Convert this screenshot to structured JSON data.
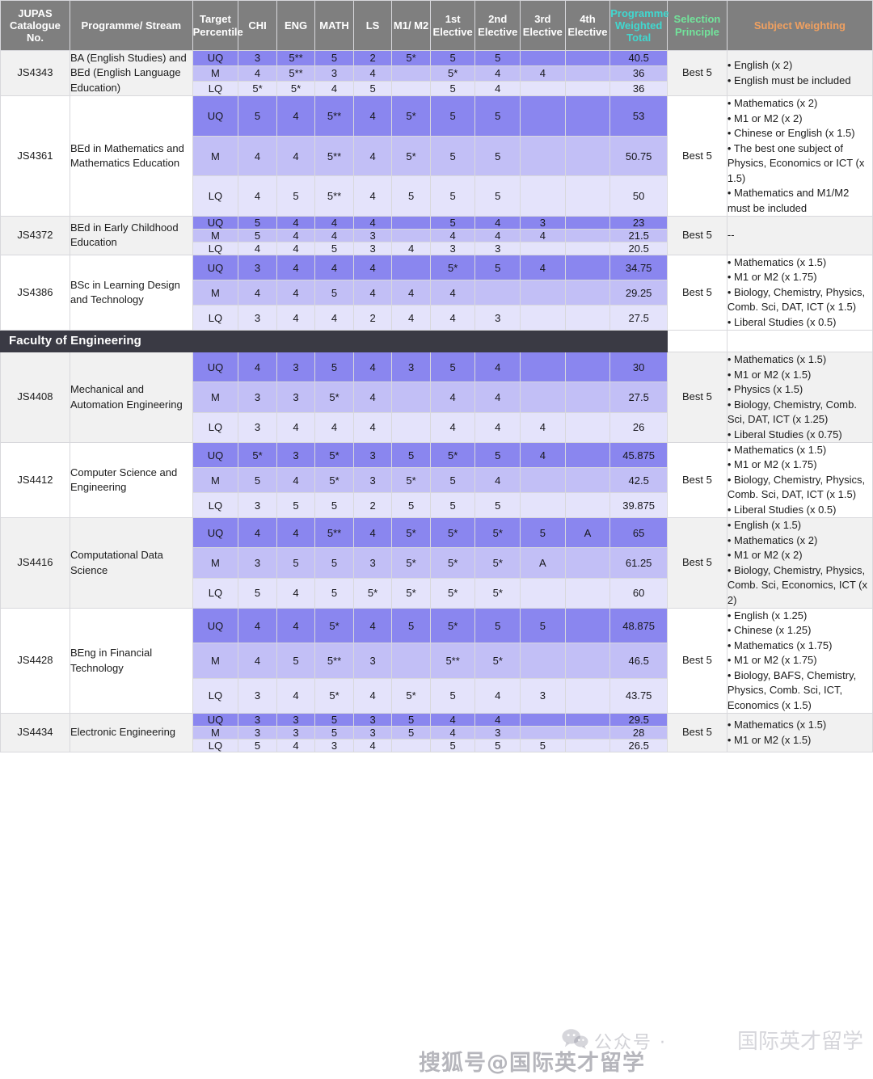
{
  "table": {
    "headers": [
      {
        "key": "jupas",
        "label": "JUPAS Catalogue No."
      },
      {
        "key": "programme",
        "label": "Programme/ Stream"
      },
      {
        "key": "target",
        "label": "Target Percentile"
      },
      {
        "key": "chi",
        "label": "CHI"
      },
      {
        "key": "eng",
        "label": "ENG"
      },
      {
        "key": "math",
        "label": "MATH"
      },
      {
        "key": "ls",
        "label": "LS"
      },
      {
        "key": "m1m2",
        "label": "M1/ M2"
      },
      {
        "key": "e1",
        "label": "1st Elective"
      },
      {
        "key": "e2",
        "label": "2nd Elective"
      },
      {
        "key": "e3",
        "label": "3rd Elective"
      },
      {
        "key": "e4",
        "label": "4th Elective"
      },
      {
        "key": "total",
        "label": "Programme Weighted Total"
      },
      {
        "key": "selection",
        "label": "Selection Principle"
      },
      {
        "key": "weighting",
        "label": "Subject Weighting"
      }
    ],
    "header_colors": {
      "background": "#7f7f7f",
      "default_text": "#ffffff",
      "programme_weighted_total": "#40d8d0",
      "selection_principle": "#72e39b",
      "subject_weighting": "#f0a060"
    },
    "quartile_colors": {
      "UQ": "#8a86ef",
      "M": "#c2bff6",
      "LQ": "#e4e3fb"
    },
    "faculty_band_color": "#3a3a44"
  },
  "sections": [
    {
      "faculty": null,
      "programmes": [
        {
          "id": "JS4343",
          "name": "BA (English Studies) and BEd (English Language Education)",
          "selection": "Best 5",
          "weighting": [
            "• English (x 2)",
            "• English must be included"
          ],
          "rows": [
            {
              "q": "UQ",
              "chi": "3",
              "eng": "5**",
              "math": "5",
              "ls": "2",
              "m1m2": "5*",
              "e1": "5",
              "e2": "5",
              "e3": "",
              "e4": "",
              "total": "40.5"
            },
            {
              "q": "M",
              "chi": "4",
              "eng": "5**",
              "math": "3",
              "ls": "4",
              "m1m2": "",
              "e1": "5*",
              "e2": "4",
              "e3": "4",
              "e4": "",
              "total": "36"
            },
            {
              "q": "LQ",
              "chi": "5*",
              "eng": "5*",
              "math": "4",
              "ls": "5",
              "m1m2": "",
              "e1": "5",
              "e2": "4",
              "e3": "",
              "e4": "",
              "total": "36"
            }
          ]
        },
        {
          "id": "JS4361",
          "name": "BEd in Mathematics and Mathematics Education",
          "selection": "Best 5",
          "weighting": [
            "• Mathematics (x 2)",
            "• M1 or M2 (x 2)",
            "• Chinese or English (x 1.5)",
            "• The best one subject of Physics, Economics or ICT (x 1.5)",
            "• Mathematics and M1/M2 must be included"
          ],
          "rows": [
            {
              "q": "UQ",
              "chi": "5",
              "eng": "4",
              "math": "5**",
              "ls": "4",
              "m1m2": "5*",
              "e1": "5",
              "e2": "5",
              "e3": "",
              "e4": "",
              "total": "53"
            },
            {
              "q": "M",
              "chi": "4",
              "eng": "4",
              "math": "5**",
              "ls": "4",
              "m1m2": "5*",
              "e1": "5",
              "e2": "5",
              "e3": "",
              "e4": "",
              "total": "50.75"
            },
            {
              "q": "LQ",
              "chi": "4",
              "eng": "5",
              "math": "5**",
              "ls": "4",
              "m1m2": "5",
              "e1": "5",
              "e2": "5",
              "e3": "",
              "e4": "",
              "total": "50"
            }
          ]
        },
        {
          "id": "JS4372",
          "name": "BEd in Early Childhood Education",
          "selection": "Best 5",
          "weighting": [
            "--"
          ],
          "rows": [
            {
              "q": "UQ",
              "chi": "5",
              "eng": "4",
              "math": "4",
              "ls": "4",
              "m1m2": "",
              "e1": "5",
              "e2": "4",
              "e3": "3",
              "e4": "",
              "total": "23"
            },
            {
              "q": "M",
              "chi": "5",
              "eng": "4",
              "math": "4",
              "ls": "3",
              "m1m2": "",
              "e1": "4",
              "e2": "4",
              "e3": "4",
              "e4": "",
              "total": "21.5"
            },
            {
              "q": "LQ",
              "chi": "4",
              "eng": "4",
              "math": "5",
              "ls": "3",
              "m1m2": "4",
              "e1": "3",
              "e2": "3",
              "e3": "",
              "e4": "",
              "total": "20.5"
            }
          ]
        },
        {
          "id": "JS4386",
          "name": "BSc in Learning Design and Technology",
          "selection": "Best 5",
          "weighting": [
            "• Mathematics (x 1.5)",
            "• M1 or M2 (x 1.75)",
            "• Biology, Chemistry, Physics, Comb. Sci, DAT, ICT (x 1.5)",
            "• Liberal Studies (x 0.5)"
          ],
          "rows": [
            {
              "q": "UQ",
              "chi": "3",
              "eng": "4",
              "math": "4",
              "ls": "4",
              "m1m2": "",
              "e1": "5*",
              "e2": "5",
              "e3": "4",
              "e4": "",
              "total": "34.75"
            },
            {
              "q": "M",
              "chi": "4",
              "eng": "4",
              "math": "5",
              "ls": "4",
              "m1m2": "4",
              "e1": "4",
              "e2": "",
              "e3": "",
              "e4": "",
              "total": "29.25"
            },
            {
              "q": "LQ",
              "chi": "3",
              "eng": "4",
              "math": "4",
              "ls": "2",
              "m1m2": "4",
              "e1": "4",
              "e2": "3",
              "e3": "",
              "e4": "",
              "total": "27.5"
            }
          ]
        }
      ]
    },
    {
      "faculty": "Faculty of Engineering",
      "programmes": [
        {
          "id": "JS4408",
          "name": "Mechanical and Automation Engineering",
          "selection": "Best 5",
          "weighting": [
            "• Mathematics (x 1.5)",
            "• M1 or M2 (x 1.5)",
            "• Physics (x 1.5)",
            "• Biology, Chemistry, Comb. Sci, DAT, ICT (x 1.25)",
            "• Liberal Studies (x 0.75)"
          ],
          "rows": [
            {
              "q": "UQ",
              "chi": "4",
              "eng": "3",
              "math": "5",
              "ls": "4",
              "m1m2": "3",
              "e1": "5",
              "e2": "4",
              "e3": "",
              "e4": "",
              "total": "30"
            },
            {
              "q": "M",
              "chi": "3",
              "eng": "3",
              "math": "5*",
              "ls": "4",
              "m1m2": "",
              "e1": "4",
              "e2": "4",
              "e3": "",
              "e4": "",
              "total": "27.5"
            },
            {
              "q": "LQ",
              "chi": "3",
              "eng": "4",
              "math": "4",
              "ls": "4",
              "m1m2": "",
              "e1": "4",
              "e2": "4",
              "e3": "4",
              "e4": "",
              "total": "26"
            }
          ]
        },
        {
          "id": "JS4412",
          "name": "Computer Science and Engineering",
          "selection": "Best 5",
          "weighting": [
            "• Mathematics (x 1.5)",
            "• M1 or M2 (x 1.75)",
            "• Biology, Chemistry, Physics, Comb. Sci, DAT, ICT (x 1.5)",
            "• Liberal Studies (x 0.5)"
          ],
          "rows": [
            {
              "q": "UQ",
              "chi": "5*",
              "eng": "3",
              "math": "5*",
              "ls": "3",
              "m1m2": "5",
              "e1": "5*",
              "e2": "5",
              "e3": "4",
              "e4": "",
              "total": "45.875"
            },
            {
              "q": "M",
              "chi": "5",
              "eng": "4",
              "math": "5*",
              "ls": "3",
              "m1m2": "5*",
              "e1": "5",
              "e2": "4",
              "e3": "",
              "e4": "",
              "total": "42.5"
            },
            {
              "q": "LQ",
              "chi": "3",
              "eng": "5",
              "math": "5",
              "ls": "2",
              "m1m2": "5",
              "e1": "5",
              "e2": "5",
              "e3": "",
              "e4": "",
              "total": "39.875"
            }
          ]
        },
        {
          "id": "JS4416",
          "name": "Computational Data Science",
          "selection": "Best 5",
          "weighting": [
            "• English (x 1.5)",
            "• Mathematics (x 2)",
            "• M1 or M2 (x 2)",
            "•  Biology, Chemistry, Physics, Comb. Sci, Economics, ICT (x 2)"
          ],
          "rows": [
            {
              "q": "UQ",
              "chi": "4",
              "eng": "4",
              "math": "5**",
              "ls": "4",
              "m1m2": "5*",
              "e1": "5*",
              "e2": "5*",
              "e3": "5",
              "e4": "A",
              "total": "65"
            },
            {
              "q": "M",
              "chi": "3",
              "eng": "5",
              "math": "5",
              "ls": "3",
              "m1m2": "5*",
              "e1": "5*",
              "e2": "5*",
              "e3": "A",
              "e4": "",
              "total": "61.25"
            },
            {
              "q": "LQ",
              "chi": "5",
              "eng": "4",
              "math": "5",
              "ls": "5*",
              "m1m2": "5*",
              "e1": "5*",
              "e2": "5*",
              "e3": "",
              "e4": "",
              "total": "60"
            }
          ]
        },
        {
          "id": "JS4428",
          "name": "BEng in Financial Technology",
          "selection": "Best 5",
          "weighting": [
            "• English (x 1.25)",
            "• Chinese (x 1.25)",
            "• Mathematics (x 1.75)",
            "• M1 or M2 (x 1.75)",
            "• Biology, BAFS, Chemistry,  Physics, Comb. Sci, ICT, Economics (x 1.5)"
          ],
          "rows": [
            {
              "q": "UQ",
              "chi": "4",
              "eng": "4",
              "math": "5*",
              "ls": "4",
              "m1m2": "5",
              "e1": "5*",
              "e2": "5",
              "e3": "5",
              "e4": "",
              "total": "48.875"
            },
            {
              "q": "M",
              "chi": "4",
              "eng": "5",
              "math": "5**",
              "ls": "3",
              "m1m2": "",
              "e1": "5**",
              "e2": "5*",
              "e3": "",
              "e4": "",
              "total": "46.5"
            },
            {
              "q": "LQ",
              "chi": "3",
              "eng": "4",
              "math": "5*",
              "ls": "4",
              "m1m2": "5*",
              "e1": "5",
              "e2": "4",
              "e3": "3",
              "e4": "",
              "total": "43.75"
            }
          ]
        },
        {
          "id": "JS4434",
          "name": "Electronic Engineering",
          "selection": "Best 5",
          "weighting": [
            "• Mathematics (x 1.5)",
            "• M1 or M2 (x 1.5)"
          ],
          "rows": [
            {
              "q": "UQ",
              "chi": "3",
              "eng": "3",
              "math": "5",
              "ls": "3",
              "m1m2": "5",
              "e1": "4",
              "e2": "4",
              "e3": "",
              "e4": "",
              "total": "29.5"
            },
            {
              "q": "M",
              "chi": "3",
              "eng": "3",
              "math": "5",
              "ls": "3",
              "m1m2": "5",
              "e1": "4",
              "e2": "3",
              "e3": "",
              "e4": "",
              "total": "28"
            },
            {
              "q": "LQ",
              "chi": "5",
              "eng": "4",
              "math": "3",
              "ls": "4",
              "m1m2": "",
              "e1": "5",
              "e2": "5",
              "e3": "5",
              "e4": "",
              "total": "26.5"
            }
          ]
        }
      ]
    }
  ],
  "watermarks": {
    "wechat": "公众号 ·",
    "sohu": "搜狐号@国际英才留学",
    "brand": "国际英才留学"
  }
}
